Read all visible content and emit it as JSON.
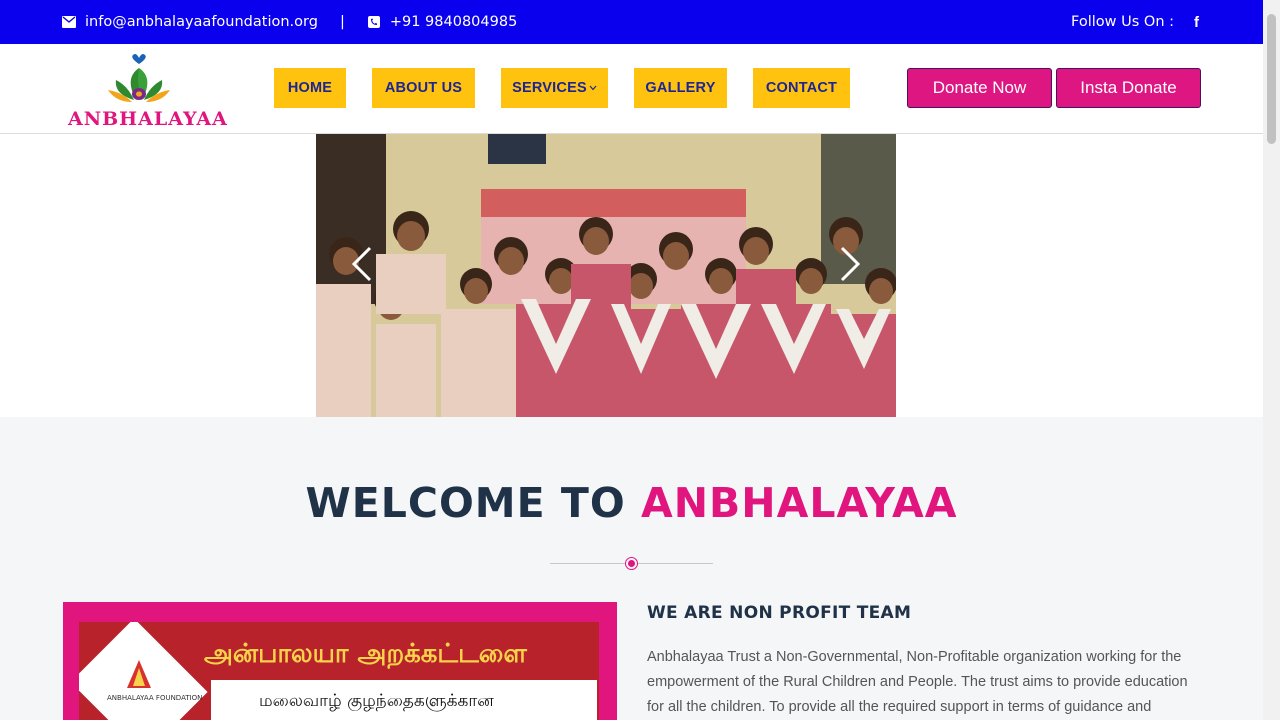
{
  "topbar": {
    "email": "info@anbhalayaafoundation.org",
    "separator": "|",
    "phone": "+91 9840804985",
    "follow_label": "Follow Us On :",
    "facebook_glyph": "f",
    "email_icon": "envelope-icon",
    "phone_icon": "phone-icon"
  },
  "logo": {
    "text": "ANBHALAYAA"
  },
  "nav": {
    "home": "HOME",
    "about": "ABOUT US",
    "services": "SERVICES",
    "gallery": "GALLERY",
    "contact": "CONTACT"
  },
  "actions": {
    "donate_now": "Donate Now",
    "insta_donate": "Insta Donate"
  },
  "banner_inner": {
    "title": "அன்பாலயா அறக்கட்டளை",
    "subtitle": "மலைவாழ் குழந்தைகளுக்கான",
    "foundation": "ANBHALAYAA FOUNDATION"
  },
  "welcome": {
    "title_part1": "WELCOME TO ",
    "title_part2": "ANBHALAYAA",
    "team_title": "WE ARE NON PROFIT TEAM",
    "team_text": "Anbhalayaa Trust a Non-Governmental, Non-Profitable organization working for the empowerment of the Rural Children and People. The trust aims to provide education for all the children. To provide all the required support in terms of guidance and"
  },
  "colors": {
    "topbar": "#0a00ee",
    "nav": "#ffc20e",
    "nav_text": "#1d2596",
    "accent": "#e0157e",
    "heading": "#203247"
  }
}
